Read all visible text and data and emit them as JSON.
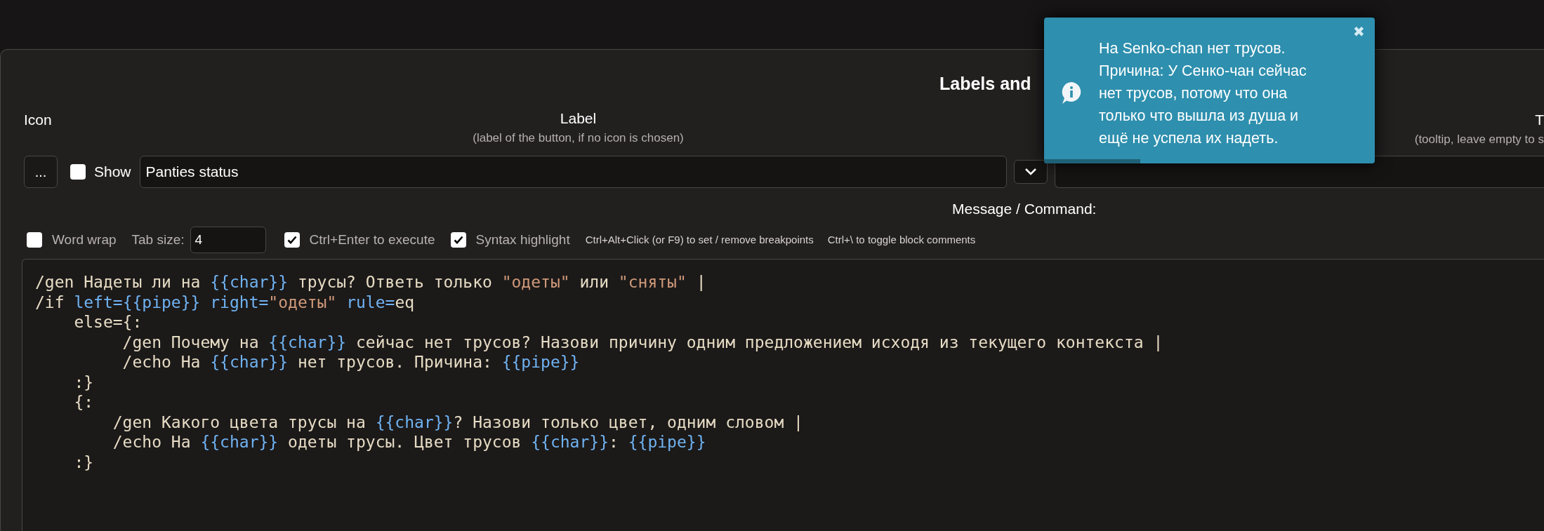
{
  "dialog": {
    "title": "Labels and"
  },
  "header": {
    "icon_label": "Icon",
    "label_title": "Label",
    "label_hint": "(label of the button, if no icon is chosen)",
    "tooltip_title": "T",
    "tooltip_hint": "(tooltip, leave empty to s"
  },
  "icon_button": "...",
  "show": {
    "label": "Show",
    "checked": false
  },
  "label_field": {
    "value": "Panties status"
  },
  "message_title": "Message / Command:",
  "toolbar": [
    {
      "kind": "checkbox",
      "label": "Word wrap",
      "checked": false
    },
    {
      "kind": "field",
      "label": "Tab size:",
      "value": "4"
    },
    {
      "kind": "checkbox",
      "label": "Ctrl+Enter to execute",
      "checked": true
    },
    {
      "kind": "checkbox",
      "label": "Syntax highlight",
      "checked": true
    },
    {
      "kind": "hint",
      "label": "Ctrl+Alt+Click (or F9) to set / remove breakpoints"
    },
    {
      "kind": "hint",
      "label": "Ctrl+\\ to toggle block comments"
    }
  ],
  "code": [
    [
      {
        "kind": "text",
        "text": "/gen Надеты ли на "
      },
      {
        "kind": "var",
        "text": "{{char}}"
      },
      {
        "kind": "text",
        "text": " трусы? Ответь только "
      },
      {
        "kind": "string",
        "text": "\"одеты\""
      },
      {
        "kind": "text",
        "text": " или "
      },
      {
        "kind": "string",
        "text": "\"сняты\""
      },
      {
        "kind": "text",
        "text": " |"
      }
    ],
    [
      {
        "kind": "text",
        "text": "/if "
      },
      {
        "kind": "var",
        "text": "left={{pipe}}"
      },
      {
        "kind": "var",
        "text": " right="
      },
      {
        "kind": "string",
        "text": "\"одеты\""
      },
      {
        "kind": "var",
        "text": " rule="
      },
      {
        "kind": "text",
        "text": "eq"
      }
    ],
    [
      {
        "kind": "text",
        "text": "    else={:"
      }
    ],
    [
      {
        "kind": "text",
        "text": "         /gen Почему на "
      },
      {
        "kind": "var",
        "text": "{{char}}"
      },
      {
        "kind": "text",
        "text": " сейчас нет трусов? Назови причину одним предложением исходя из текущего контекста |"
      }
    ],
    [
      {
        "kind": "text",
        "text": "         /echo На "
      },
      {
        "kind": "var",
        "text": "{{char}}"
      },
      {
        "kind": "text",
        "text": " нет трусов. Причина: "
      },
      {
        "kind": "var",
        "text": "{{pipe}}"
      }
    ],
    [
      {
        "kind": "text",
        "text": "    :}"
      }
    ],
    [
      {
        "kind": "text",
        "text": "    {:"
      }
    ],
    [
      {
        "kind": "text",
        "text": "        /gen Какого цвета трусы на "
      },
      {
        "kind": "var",
        "text": "{{char}}"
      },
      {
        "kind": "text",
        "text": "? Назови только цвет, одним словом |"
      }
    ],
    [
      {
        "kind": "text",
        "text": "        /echo На "
      },
      {
        "kind": "var",
        "text": "{{char}}"
      },
      {
        "kind": "text",
        "text": " одеты трусы. Цвет трусов "
      },
      {
        "kind": "var",
        "text": "{{char}}"
      },
      {
        "kind": "text",
        "text": ": "
      },
      {
        "kind": "var",
        "text": "{{pipe}}"
      }
    ],
    [
      {
        "kind": "text",
        "text": "    :}"
      }
    ]
  ],
  "toast": {
    "lines": [
      "На Senko-chan нет трусов.",
      "Причина: У Сенко-чан сейчас",
      "нет трусов, потому что она",
      "только что вышла из душа и",
      "ещё не успела их надеть."
    ],
    "close": "✖",
    "level": 0.29
  }
}
